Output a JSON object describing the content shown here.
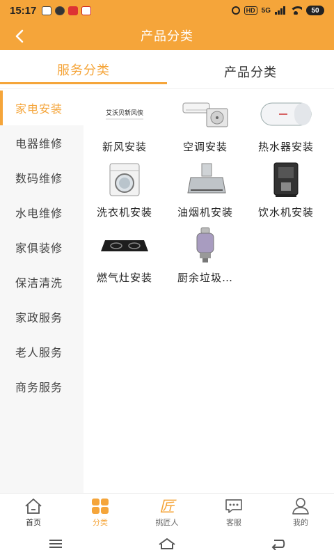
{
  "status_bar": {
    "time": "15:17",
    "network": "5G",
    "hd": "HD",
    "battery": "50"
  },
  "header": {
    "title": "产品分类",
    "back_icon": "chevron-left-icon"
  },
  "tabs": [
    {
      "label": "服务分类",
      "active": true
    },
    {
      "label": "产品分类",
      "active": false
    }
  ],
  "sidebar": {
    "items": [
      {
        "label": "家电安装",
        "active": true
      },
      {
        "label": "电器维修"
      },
      {
        "label": "数码维修"
      },
      {
        "label": "水电维修"
      },
      {
        "label": "家俱装修"
      },
      {
        "label": "保洁清洗"
      },
      {
        "label": "家政服务"
      },
      {
        "label": "老人服务"
      },
      {
        "label": "商务服务"
      }
    ]
  },
  "products": {
    "logo_text": "艾沃贝新风侠",
    "items": [
      {
        "label": "新风安装",
        "icon": "fresh-air-logo"
      },
      {
        "label": "空调安装",
        "icon": "air-conditioner"
      },
      {
        "label": "热水器安装",
        "icon": "water-heater"
      },
      {
        "label": "洗衣机安装",
        "icon": "washing-machine"
      },
      {
        "label": "油烟机安装",
        "icon": "range-hood"
      },
      {
        "label": "饮水机安装",
        "icon": "water-dispenser"
      },
      {
        "label": "燃气灶安装",
        "icon": "gas-stove"
      },
      {
        "label": "厨余垃圾…",
        "icon": "food-waste-disposer"
      }
    ]
  },
  "bottom_nav": {
    "items": [
      {
        "label": "首页",
        "icon": "home-icon"
      },
      {
        "label": "分类",
        "icon": "category-icon",
        "current": true
      },
      {
        "label": "挑匠人",
        "icon": "craftsman-icon"
      },
      {
        "label": "客服",
        "icon": "chat-icon"
      },
      {
        "label": "我的",
        "icon": "user-icon"
      }
    ]
  },
  "colors": {
    "accent": "#f5a53a",
    "sidebar_bg": "#f7f7f7"
  }
}
